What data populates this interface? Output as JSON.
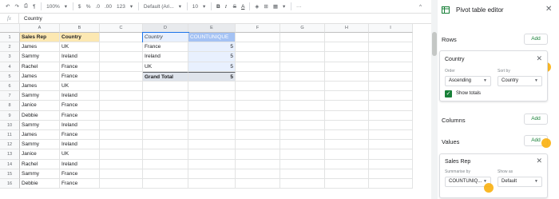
{
  "toolbar": {
    "undo_icon": "undo-icon",
    "redo_icon": "redo-icon",
    "print_icon": "print-icon",
    "paint_format_icon": "paint-format-icon",
    "zoom": "100%",
    "currency": "$",
    "percent": "%",
    "dec_decrease": ".0",
    "dec_increase": ".00",
    "more_formats": "123",
    "font": "Default (Ari...",
    "font_size": "10",
    "bold": "B",
    "italic": "I",
    "strike": "S",
    "text_color": "A",
    "more": "···",
    "collapse": "^"
  },
  "formula_bar": {
    "fx": "fx",
    "value": "Country"
  },
  "columns": [
    "A",
    "B",
    "C",
    "D",
    "E",
    "F",
    "G",
    "H",
    "I"
  ],
  "rows": [
    {
      "n": "1",
      "a": "Sales Rep",
      "b": "Country"
    },
    {
      "n": "2",
      "a": "James",
      "b": "UK"
    },
    {
      "n": "3",
      "a": "Sammy",
      "b": "Ireland"
    },
    {
      "n": "4",
      "a": "Rachel",
      "b": "France"
    },
    {
      "n": "5",
      "a": "James",
      "b": "France"
    },
    {
      "n": "6",
      "a": "James",
      "b": "UK"
    },
    {
      "n": "7",
      "a": "Sammy",
      "b": "Ireland"
    },
    {
      "n": "8",
      "a": "Janice",
      "b": "France"
    },
    {
      "n": "9",
      "a": "Debbie",
      "b": "France"
    },
    {
      "n": "10",
      "a": "Sammy",
      "b": "Ireland"
    },
    {
      "n": "11",
      "a": "James",
      "b": "France"
    },
    {
      "n": "12",
      "a": "Sammy",
      "b": "Ireland"
    },
    {
      "n": "13",
      "a": "Janice",
      "b": "UK"
    },
    {
      "n": "14",
      "a": "Rachel",
      "b": "Ireland"
    },
    {
      "n": "15",
      "a": "Sammy",
      "b": "France"
    },
    {
      "n": "16",
      "a": "Debbie",
      "b": "France"
    }
  ],
  "pivot": {
    "header_d": "Country",
    "header_e": "COUNTUNIQUE",
    "rows": [
      {
        "label": "France",
        "value": "5"
      },
      {
        "label": "Ireland",
        "value": "5"
      },
      {
        "label": "UK",
        "value": "5"
      }
    ],
    "total_label": "Grand Total",
    "total_value": "5"
  },
  "panel": {
    "title": "Pivot table editor",
    "rows_label": "Rows",
    "add_label": "Add",
    "rows_card": {
      "title": "Country",
      "order_label": "Order",
      "order_value": "Ascending",
      "sortby_label": "Sort by",
      "sortby_value": "Country",
      "show_totals": "Show totals"
    },
    "columns_label": "Columns",
    "values_label": "Values",
    "values_card": {
      "title": "Sales Rep",
      "summarise_label": "Summarise by",
      "summarise_value": "COUNTUNIQ...",
      "showas_label": "Show as",
      "showas_value": "Default"
    }
  },
  "colors": {
    "header_fill": "#fce8b2",
    "pivot_header": "#a4c2f4",
    "pivot_body": "#e8f0fe",
    "green": "#188038",
    "cursor": "#f9ab00"
  }
}
